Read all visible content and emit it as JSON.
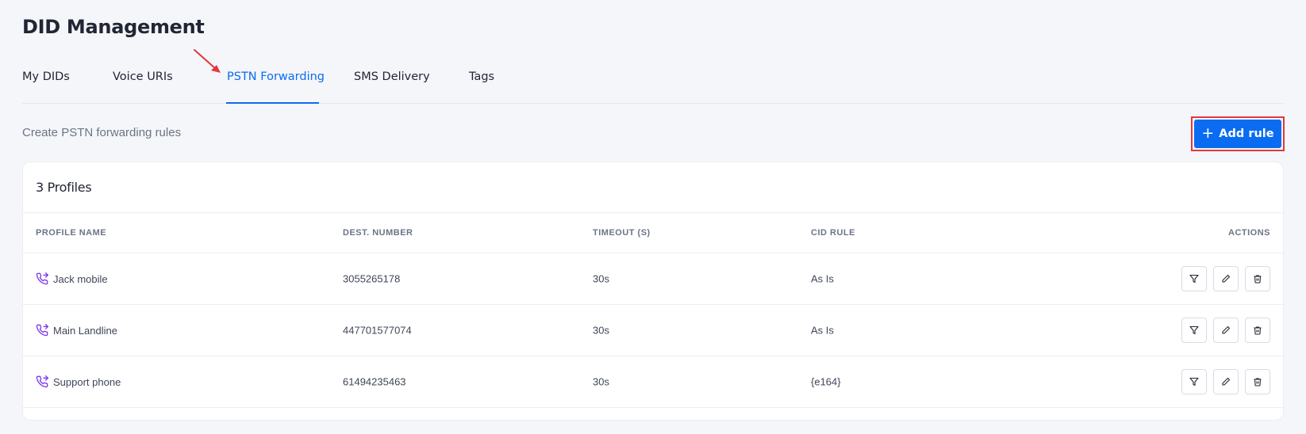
{
  "page": {
    "title": "DID Management"
  },
  "tabs": [
    {
      "label": "My DIDs"
    },
    {
      "label": "Voice URIs"
    },
    {
      "label": "PSTN Forwarding"
    },
    {
      "label": "SMS Delivery"
    },
    {
      "label": "Tags"
    }
  ],
  "active_tab": "PSTN Forwarding",
  "subtitle": "Create PSTN forwarding rules",
  "add_button": {
    "label": "Add rule",
    "icon": "plus-icon"
  },
  "card": {
    "title": "3 Profiles",
    "columns": {
      "profile_name": "PROFILE NAME",
      "dest_number": "DEST. NUMBER",
      "timeout": "TIMEOUT (S)",
      "cid_rule": "CID RULE",
      "actions": "ACTIONS"
    },
    "rows": [
      {
        "profile_name": "Jack mobile",
        "dest_number": "3055265178",
        "timeout": "30s",
        "cid_rule": "As Is"
      },
      {
        "profile_name": "Main Landline",
        "dest_number": "447701577074",
        "timeout": "30s",
        "cid_rule": "As Is"
      },
      {
        "profile_name": "Support phone",
        "dest_number": "61494235463",
        "timeout": "30s",
        "cid_rule": "{e164}"
      }
    ]
  },
  "colors": {
    "accent": "#0a6cf1",
    "phone_icon": "#7c3aed",
    "annotation": "#e0383e"
  },
  "icons": {
    "row_icon": "phone-forward-icon",
    "actions": [
      "filter-icon",
      "edit-icon",
      "trash-icon"
    ]
  }
}
